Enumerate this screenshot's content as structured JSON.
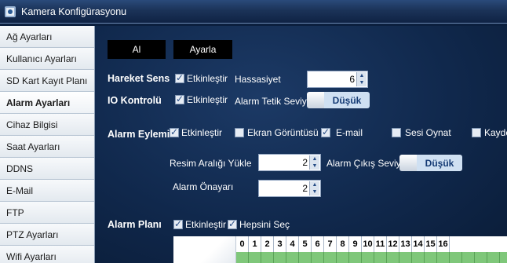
{
  "window": {
    "title": "Kamera Konfigürasyonu"
  },
  "sidebar": {
    "items": [
      {
        "label": "Ağ Ayarları"
      },
      {
        "label": "Kullanıcı Ayarları"
      },
      {
        "label": "SD Kart Kayıt Planı"
      },
      {
        "label": "Alarm Ayarları",
        "active": true
      },
      {
        "label": "Cihaz Bilgisi"
      },
      {
        "label": "Saat Ayarları"
      },
      {
        "label": "DDNS"
      },
      {
        "label": "E-Mail"
      },
      {
        "label": "FTP"
      },
      {
        "label": "PTZ Ayarları"
      },
      {
        "label": "Wifi Ayarları"
      }
    ]
  },
  "toolbar": {
    "al_label": "Al",
    "ayarla_label": "Ayarla"
  },
  "motion": {
    "label": "Hareket Sens",
    "enable_label": "Etkinleştir",
    "sensitivity_label": "Hassasiyet",
    "sensitivity_value": "6"
  },
  "io": {
    "label": "IO Kontrolü",
    "enable_label": "Etkinleştir",
    "trigger_label": "Alarm Tetik Seviy",
    "trigger_value": "Düşük"
  },
  "action": {
    "label": "Alarm Eylemi",
    "enable_label": "Etkinleştir",
    "screenshot_label": "Ekran Görüntüsü",
    "email_label": "E-mail",
    "sound_label": "Sesi Oynat",
    "record_label": "Kayde",
    "interval_label": "Resim Aralığı Yükle",
    "interval_value": "2",
    "output_label": "Alarm Çıkış Seviy",
    "output_value": "Düşük",
    "preset_label": "Alarm Önayarı",
    "preset_value": "2"
  },
  "schedule": {
    "label": "Alarm Planı",
    "enable_label": "Etkinleştir",
    "select_all_label": "Hepsini Seç",
    "hours": [
      "0",
      "1",
      "2",
      "3",
      "4",
      "5",
      "6",
      "7",
      "8",
      "9",
      "10",
      "11",
      "12",
      "13",
      "14",
      "15",
      "16"
    ]
  },
  "colors": {
    "accent": "#143a74",
    "background": "#10284c",
    "grid_green": "#7fc77a"
  }
}
